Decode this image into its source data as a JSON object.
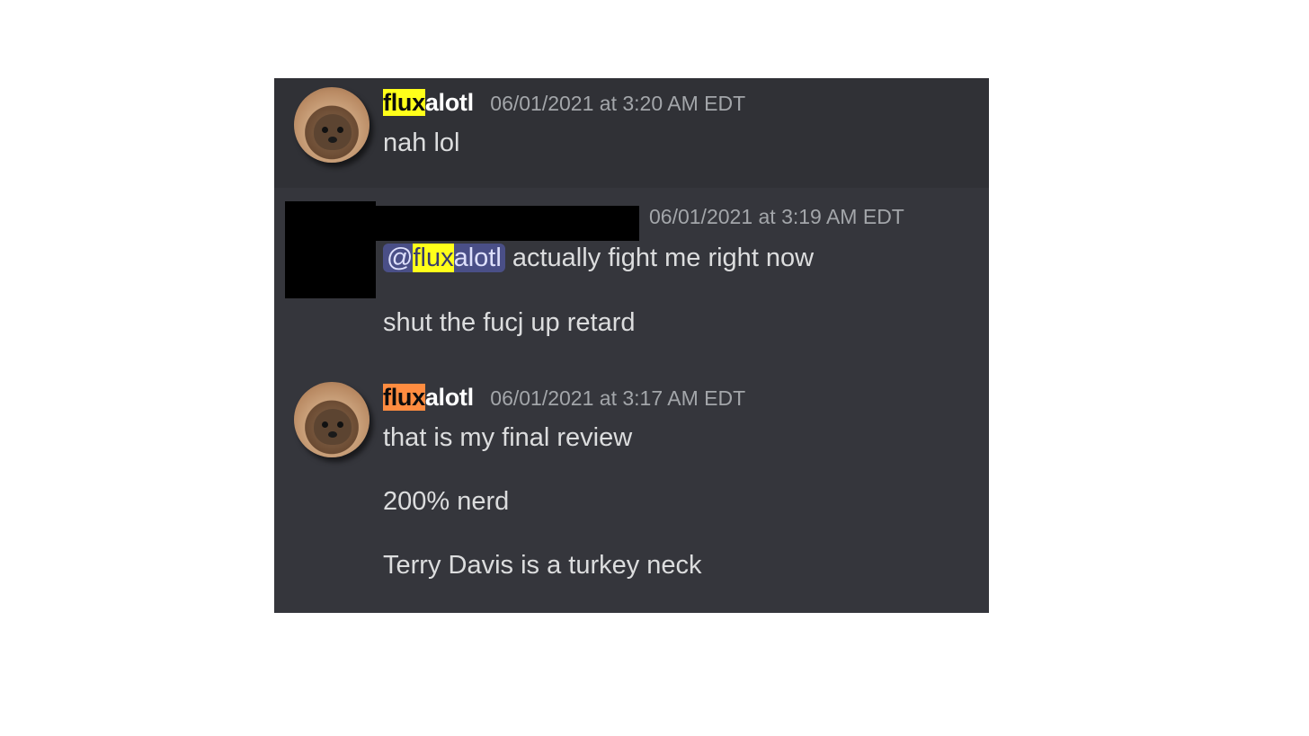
{
  "messages": [
    {
      "user_highlight": "flux",
      "user_rest": "alotl",
      "timestamp": "06/01/2021 at 3:20 AM EDT",
      "lines": [
        "nah lol"
      ]
    },
    {
      "timestamp": "06/01/2021 at 3:19 AM EDT",
      "mention_prefix": "@",
      "mention_highlight": "flux",
      "mention_rest": "alotl",
      "first_line_rest": "actually fight me right now",
      "lines": [
        "shut the fucj up retard"
      ]
    },
    {
      "user_highlight": "flux",
      "user_rest": "alotl",
      "timestamp": "06/01/2021 at 3:17 AM EDT",
      "lines": [
        "that is my final review",
        "200% nerd",
        "Terry Davis is a turkey neck"
      ]
    }
  ],
  "colors": {
    "chat_bg": "#35363c",
    "hover_bg": "#303136",
    "highlight_yellow": "#ffff1a",
    "highlight_orange": "#ff8c40",
    "mention_bg": "#4a4f87"
  }
}
